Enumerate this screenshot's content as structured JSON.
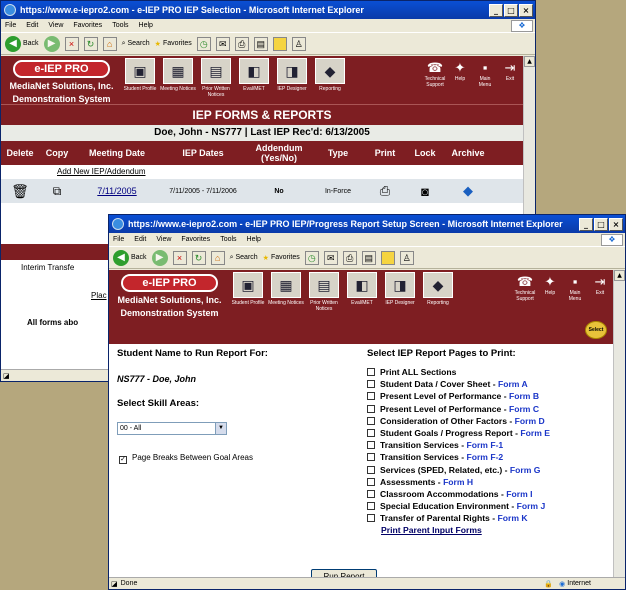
{
  "back_window": {
    "title": "https://www.e-iepro2.com - e-IEP PRO IEP Selection - Microsoft Internet Explorer",
    "menu": [
      "File",
      "Edit",
      "View",
      "Favorites",
      "Tools",
      "Help"
    ],
    "toolbar": {
      "back": "Back",
      "search": "Search",
      "favorites": "Favorites"
    },
    "logo": "e-IEP PRO",
    "company": [
      "MediaNet Solutions, Inc.",
      "Demonstration System"
    ],
    "nav": [
      "Student Profile",
      "Meeting Notices",
      "Prior Written Notices",
      "Eval/MET",
      "IEP Designer",
      "Reporting"
    ],
    "right_nav": [
      "Technical Support",
      "Help",
      "Main Menu",
      "Exit"
    ],
    "banner": "IEP FORMS & REPORTS",
    "student_line": "Doe, John - NS777  |  Last IEP Rec'd: 6/13/2005",
    "columns": [
      "Delete",
      "Copy",
      "Meeting Date",
      "IEP Dates",
      "Addendum (Yes/No)",
      "Type",
      "Print",
      "Lock",
      "Archive"
    ],
    "add_new": "Add New IEP/Addendum",
    "row": {
      "meeting_date": "7/11/2005",
      "iep_dates": "7/11/2005 - 7/11/2006",
      "addendum": "No",
      "type": "In-Force"
    },
    "fragments": [
      "Interim Transfe",
      "Plac",
      "All forms abo"
    ]
  },
  "front_window": {
    "title": "https://www.e-iepro2.com - e-IEP PRO IEP/Progress Report Setup Screen - Microsoft Internet Explorer",
    "select_label": "Select",
    "student_heading": "Student Name to Run Report For:",
    "student_value": "NS777 - Doe, John",
    "skill_heading": "Select Skill Areas:",
    "skill_value": "00 - All",
    "page_breaks": "Page Breaks Between Goal Areas",
    "pages_heading": "Select IEP Report Pages to Print:",
    "pages": [
      {
        "label": "Print ALL Sections",
        "form": ""
      },
      {
        "label": "Student Data / Cover Sheet - ",
        "form": "Form A"
      },
      {
        "label": "Present Level of Performance - ",
        "form": "Form B"
      },
      {
        "label": "Present Level of Performance - ",
        "form": "Form C"
      },
      {
        "label": "Consideration of Other Factors - ",
        "form": "Form D"
      },
      {
        "label": "Student Goals / Progress Report - ",
        "form": "Form E"
      },
      {
        "label": "Transition Services - ",
        "form": "Form F-1"
      },
      {
        "label": "Transition Services - ",
        "form": "Form F-2"
      },
      {
        "label": "Services (SPED, Related, etc.) - ",
        "form": "Form G"
      },
      {
        "label": "Assessments - ",
        "form": "Form H"
      },
      {
        "label": "Classroom Accommodations - ",
        "form": "Form I"
      },
      {
        "label": "Special Education Environment - ",
        "form": "Form J"
      },
      {
        "label": "Transfer of Parental Rights - ",
        "form": "Form K"
      }
    ],
    "print_parent": "Print Parent Input Forms",
    "run_button": "Run Report",
    "status_left": "Done",
    "status_right": "Internet"
  },
  "colors": {
    "maroon": "#7e1e22",
    "link_blue": "#1a35c8",
    "xp_blue": "#0a3aa8"
  }
}
